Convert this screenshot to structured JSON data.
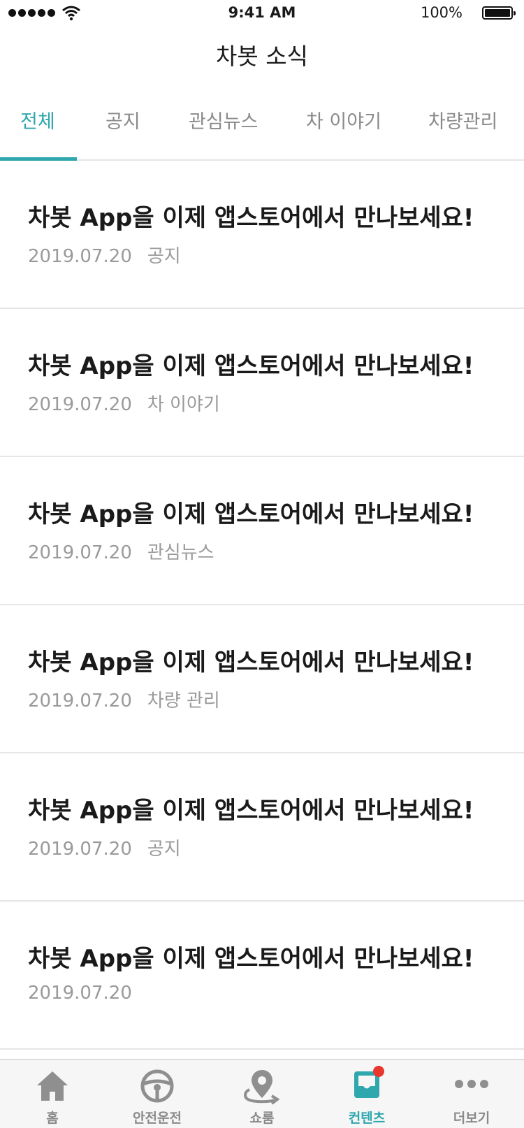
{
  "status_bar": {
    "time": "9:41 AM",
    "battery": "100%"
  },
  "page_title": "차봇 소식",
  "tabs": [
    {
      "label": "전체"
    },
    {
      "label": "공지"
    },
    {
      "label": "관심뉴스"
    },
    {
      "label": "차 이야기"
    },
    {
      "label": "차량관리"
    }
  ],
  "active_tab": "전체",
  "posts": [
    {
      "title": "차봇 App을 이제 앱스토어에서 만나보세요!",
      "date": "2019.07.20",
      "category": "공지"
    },
    {
      "title": "차봇 App을 이제 앱스토어에서 만나보세요!",
      "date": "2019.07.20",
      "category": "차 이야기"
    },
    {
      "title": "차봇 App을 이제 앱스토어에서 만나보세요!",
      "date": "2019.07.20",
      "category": "관심뉴스"
    },
    {
      "title": "차봇 App을 이제 앱스토어에서 만나보세요!",
      "date": "2019.07.20",
      "category": "차량 관리"
    },
    {
      "title": "차봇 App을 이제 앱스토어에서 만나보세요!",
      "date": "2019.07.20",
      "category": "공지"
    },
    {
      "title": "차봇 App을 이제 앱스토어에서 만나보세요!",
      "date": "2019.07.20",
      "category": ""
    }
  ],
  "bottom_nav": [
    {
      "label": "홈",
      "icon": "home-icon"
    },
    {
      "label": "안전운전",
      "icon": "steering-wheel-icon"
    },
    {
      "label": "쇼룸",
      "icon": "location-pin-icon"
    },
    {
      "label": "컨텐츠",
      "icon": "inbox-icon",
      "active": true,
      "badge": true
    },
    {
      "label": "더보기",
      "icon": "more-dots-icon"
    }
  ],
  "colors": {
    "accent": "#2ea7ad",
    "badge": "#e8372f",
    "inactive": "#8a8a8a"
  }
}
